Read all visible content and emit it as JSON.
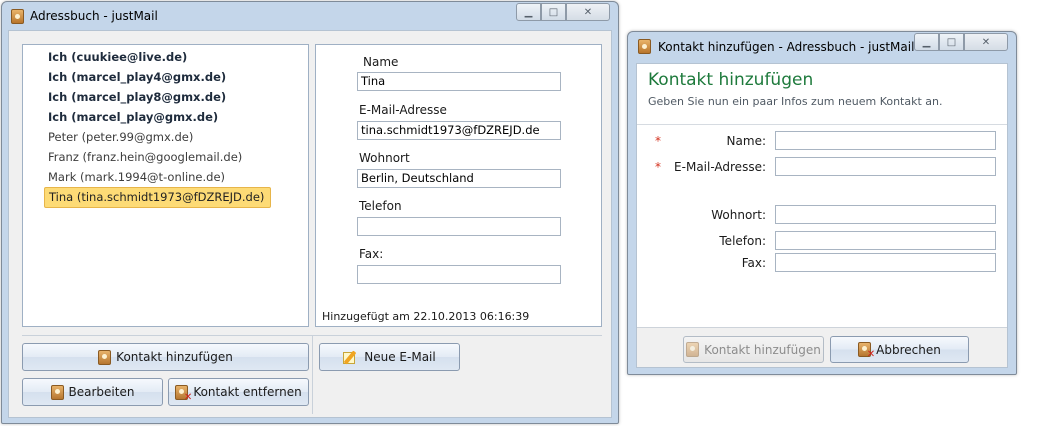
{
  "main": {
    "title": "Adressbuch - justMail",
    "contacts": [
      {
        "label": "Ich (cuukiee@live.de)"
      },
      {
        "label": "Ich (marcel_play4@gmx.de)"
      },
      {
        "label": "Ich (marcel_play8@gmx.de)"
      },
      {
        "label": "Ich (marcel_play@gmx.de)"
      },
      {
        "label": "Peter (peter.99@gmx.de)"
      },
      {
        "label": "Franz (franz.hein@googlemail.de)"
      },
      {
        "label": "Mark (mark.1994@t-online.de)"
      },
      {
        "label": "Tina (tina.schmidt1973@fDZREJD.de)"
      }
    ],
    "details": {
      "name_label": "Name",
      "name_value": "Tina",
      "email_label": "E-Mail-Adresse",
      "email_value": "tina.schmidt1973@fDZREJD.de",
      "city_label": "Wohnort",
      "city_value": "Berlin, Deutschland",
      "phone_label": "Telefon",
      "phone_value": "",
      "fax_label": "Fax:",
      "fax_value": "",
      "added_text": "Hinzugefügt am 22.10.2013 06:16:39"
    },
    "buttons": {
      "add": "Kontakt hinzufügen",
      "edit": "Bearbeiten",
      "remove": "Kontakt entfernen",
      "new_mail": "Neue E-Mail"
    }
  },
  "dialog": {
    "title": "Kontakt hinzufügen - Adressbuch - justMail",
    "heading": "Kontakt hinzufügen",
    "subtitle": "Geben Sie nun ein paar Infos zum neuem Kontakt an.",
    "required_mark": "*",
    "fields": {
      "name_label": "Name:",
      "email_label": "E-Mail-Adresse:",
      "city_label": "Wohnort:",
      "phone_label": "Telefon:",
      "fax_label": "Fax:"
    },
    "buttons": {
      "add": "Kontakt hinzufügen",
      "cancel": "Abbrechen"
    }
  },
  "colors": {
    "heading_green": "#1e7a3c",
    "selection": "#fddb76",
    "required": "#d3301d"
  }
}
